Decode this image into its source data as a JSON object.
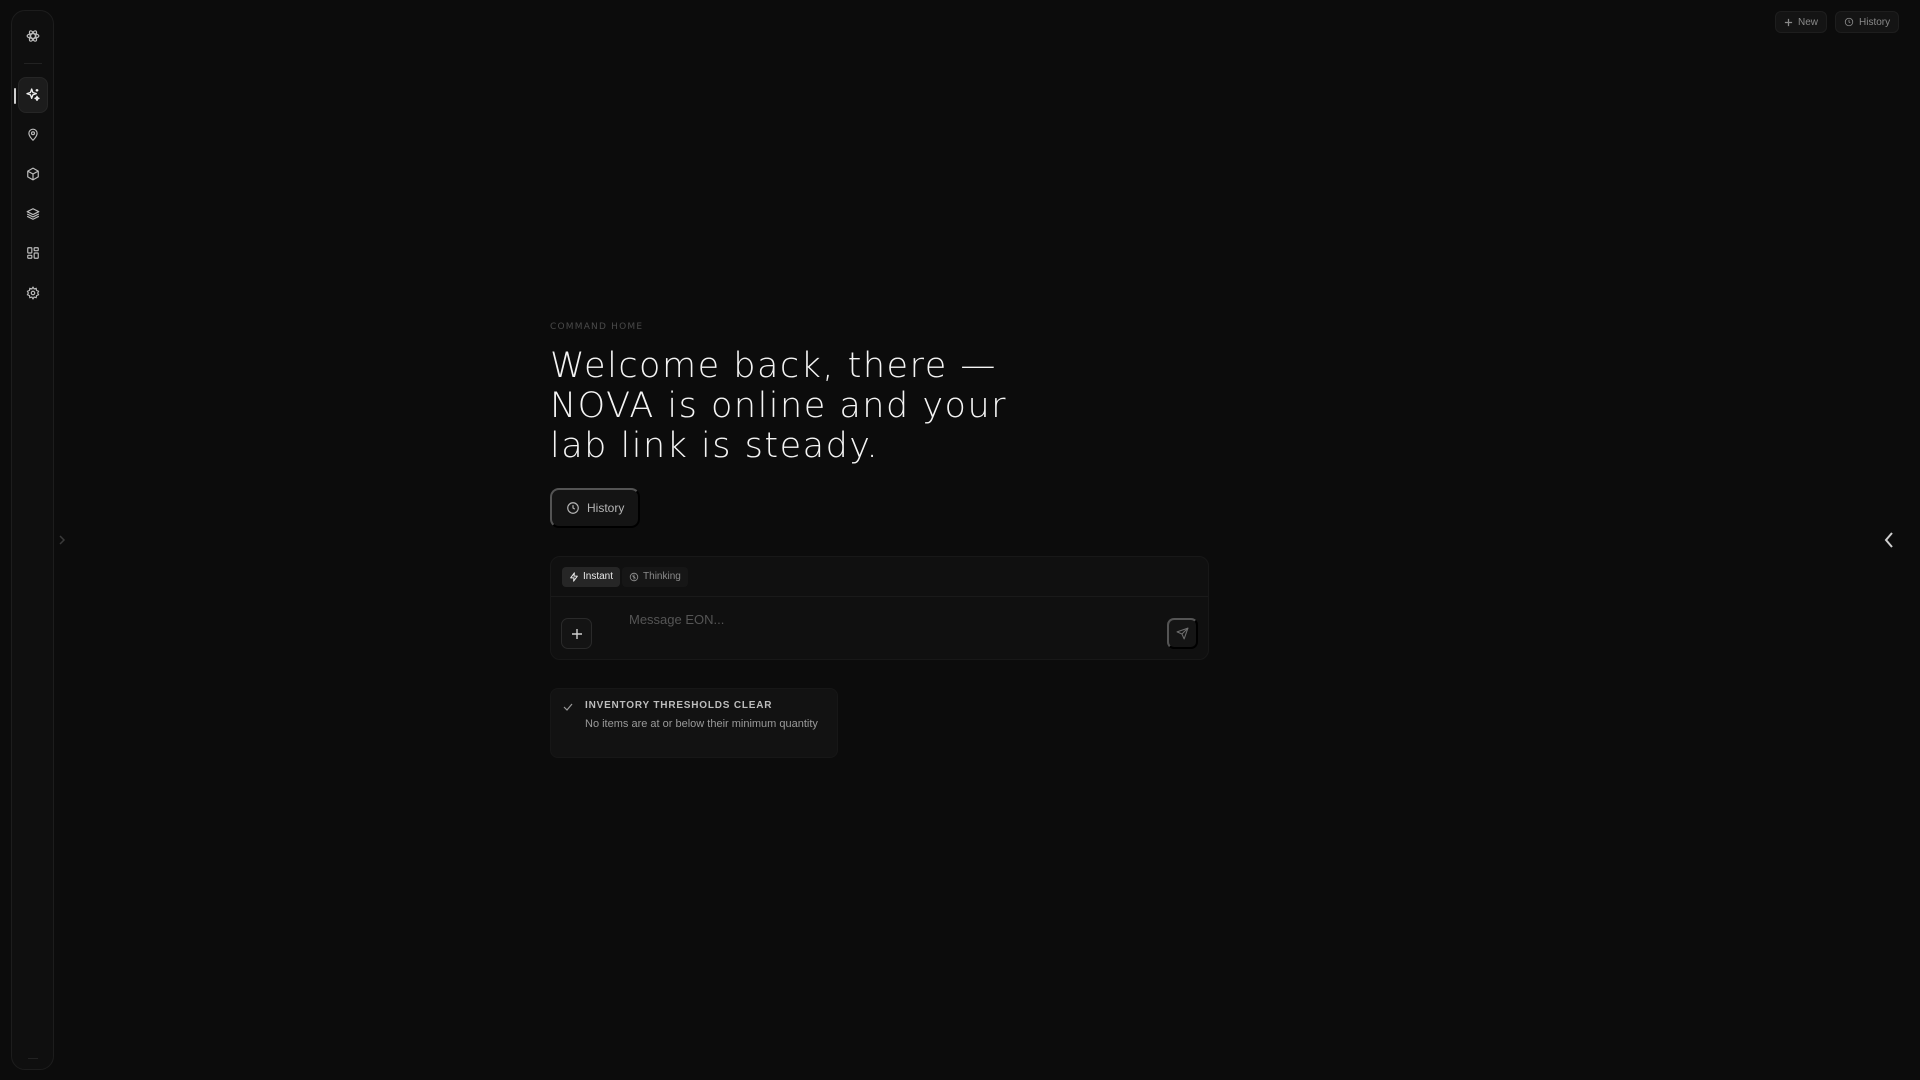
{
  "sidebar": {
    "logo_icon": "atom-logo-icon",
    "items": [
      {
        "name": "sparkles",
        "icon": "sparkles-icon",
        "active": true
      },
      {
        "name": "location",
        "icon": "map-pin-icon",
        "active": false
      },
      {
        "name": "inventory",
        "icon": "box-icon",
        "active": false
      },
      {
        "name": "layers",
        "icon": "layers-icon",
        "active": false
      },
      {
        "name": "dashboard",
        "icon": "grid-icon",
        "active": false
      },
      {
        "name": "settings",
        "icon": "gear-icon",
        "active": false
      }
    ]
  },
  "topbar": {
    "new_label": "New",
    "history_label": "History"
  },
  "main": {
    "eyebrow": "COMMAND HOME",
    "headline": "Welcome back, there — NOVA is online and your lab link is steady.",
    "history_button_label": "History"
  },
  "composer": {
    "modes": [
      {
        "label": "Instant",
        "icon": "bolt-icon",
        "active": true
      },
      {
        "label": "Thinking",
        "icon": "brain-icon",
        "active": false
      }
    ],
    "placeholder": "Message EON...",
    "value": ""
  },
  "status": {
    "title": "INVENTORY THRESHOLDS CLEAR",
    "subtitle": "No items are at or below their minimum quantity"
  },
  "colors": {
    "background": "#0c0c0c",
    "panel": "#101010",
    "text": "#f4f4f4",
    "muted": "#8a8a8a"
  }
}
